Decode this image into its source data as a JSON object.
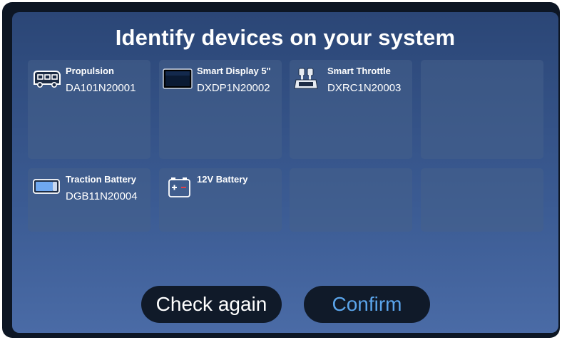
{
  "title": "Identify devices on your system",
  "devices": [
    {
      "name": "Propulsion",
      "serial": "DA101N20001",
      "icon": "motorhome-icon"
    },
    {
      "name": "Smart Display 5\"",
      "serial": "DXDP1N20002",
      "icon": "display-icon"
    },
    {
      "name": "Smart Throttle",
      "serial": "DXRC1N20003",
      "icon": "throttle-icon"
    },
    {
      "name": "Traction Battery",
      "serial": "DGB11N20004",
      "icon": "traction-battery-icon"
    },
    {
      "name": "12V Battery",
      "serial": "",
      "icon": "12v-battery-icon"
    }
  ],
  "buttons": {
    "check_again": "Check again",
    "confirm": "Confirm"
  },
  "colors": {
    "background_top": "#2b4676",
    "background_bottom": "#4a6ba6",
    "card": "#46608a",
    "button_bg": "#101a29",
    "confirm_text": "#5aa4ea",
    "battery_minus": "#e0404a"
  }
}
